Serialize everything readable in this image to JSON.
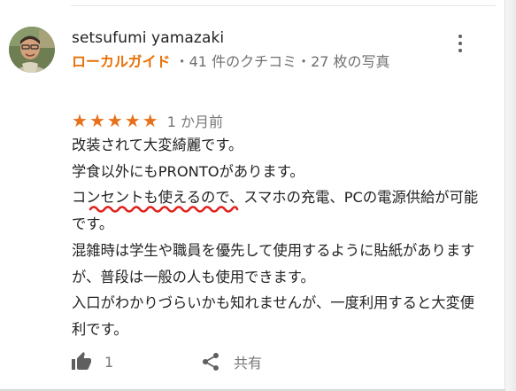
{
  "review": {
    "reviewer": {
      "name": "setsufumi yamazaki",
      "badge": "ローカルガイド",
      "stats": "・41 件のクチコミ・27 枚の写真"
    },
    "rating": {
      "stars": 5,
      "max": 5,
      "time": "1 か月前"
    },
    "body": [
      "改装されて大変綺麗です。",
      "学食以外にもPRONTOがあります。",
      "コンセントも使えるので、スマホの充電、PCの電源供給が可能です。",
      "混雑時は学生や職員を優先して使用するように貼紙がありますが、普段は一般の人も使用できます。",
      "入口がわかりづらいかも知れませんが、一度利用すると大変便利です。"
    ],
    "actions": {
      "like_count": "1",
      "share_label": "共有"
    }
  },
  "colors": {
    "accent_orange": "#e8710a",
    "star": "#e7711b",
    "annotation_red": "#e0201c",
    "secondary_text": "#777777"
  },
  "icons": {
    "more": "more-vert-icon",
    "like": "thumb-up-icon",
    "share": "share-icon"
  }
}
